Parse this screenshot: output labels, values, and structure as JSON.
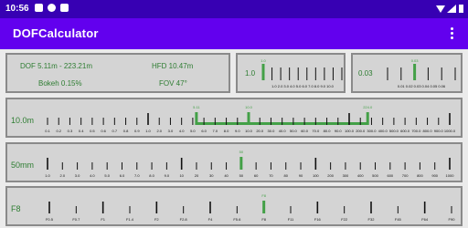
{
  "status_bar": {
    "time": "10:56"
  },
  "app_bar": {
    "title": "DOFCalculator"
  },
  "summary": {
    "dof": "DOF 5.11m - 223.21m",
    "hfd": "HFD 10.47m",
    "bokeh": "Bokeh 0.15%",
    "fov": "FOV 47°"
  },
  "mini_scales": [
    {
      "label": "1.0",
      "marker_label": "1.0",
      "ticks": [
        "1.0",
        "2.0",
        "3.0",
        "4.0",
        "5.0",
        "6.0",
        "7.0",
        "8.0",
        "9.0",
        "10.0"
      ],
      "marked_index": 0,
      "tick_text": "1.0 2.0 3.0 4.0 5.0 6.0 7.0 8.0 9.0 10.0"
    },
    {
      "label": "0.03",
      "marker_label": "0.03",
      "ticks": [
        "0.01",
        "0.02",
        "0.03",
        "0.04",
        "0.05",
        "0.06"
      ],
      "marked_index": 2,
      "tick_text": "0.01 0.02 0.03 0.04 0.05 0.06"
    }
  ],
  "scales": [
    {
      "label": "10.0m",
      "ticks": [
        "0.1",
        "0.2",
        "0.3",
        "0.4",
        "0.5",
        "0.6",
        "0.7",
        "0.8",
        "0.9",
        "1.0",
        "2.0",
        "3.0",
        "4.0",
        "5.0",
        "6.0",
        "7.0",
        "8.0",
        "9.0",
        "10.0",
        "20.0",
        "30.0",
        "40.0",
        "50.0",
        "60.0",
        "70.0",
        "80.0",
        "90.0",
        "100.0",
        "200.0",
        "300.0",
        "400.0",
        "500.0",
        "600.0",
        "700.0",
        "800.0",
        "900.0",
        "1000.0"
      ],
      "highlight_values": [
        "5.11",
        "10.0",
        "224.0"
      ],
      "range_from": "5.11",
      "range_to": "224.0"
    },
    {
      "label": "50mm",
      "ticks": [
        "1.0",
        "2.0",
        "3.0",
        "4.0",
        "5.0",
        "6.0",
        "7.0",
        "8.0",
        "9.0",
        "10",
        "20",
        "30",
        "40",
        "50",
        "60",
        "70",
        "80",
        "90",
        "100",
        "200",
        "300",
        "400",
        "500",
        "600",
        "700",
        "800",
        "900",
        "1000"
      ],
      "highlight_values": [
        "50"
      ]
    },
    {
      "label": "F8",
      "ticks": [
        "F0.5",
        "F0.7",
        "F1",
        "F1.4",
        "F2",
        "F2.8",
        "F4",
        "F5.6",
        "F8",
        "F11",
        "F16",
        "F22",
        "F32",
        "F45",
        "F64",
        "F90"
      ],
      "highlight_values": [
        "F8"
      ]
    }
  ]
}
